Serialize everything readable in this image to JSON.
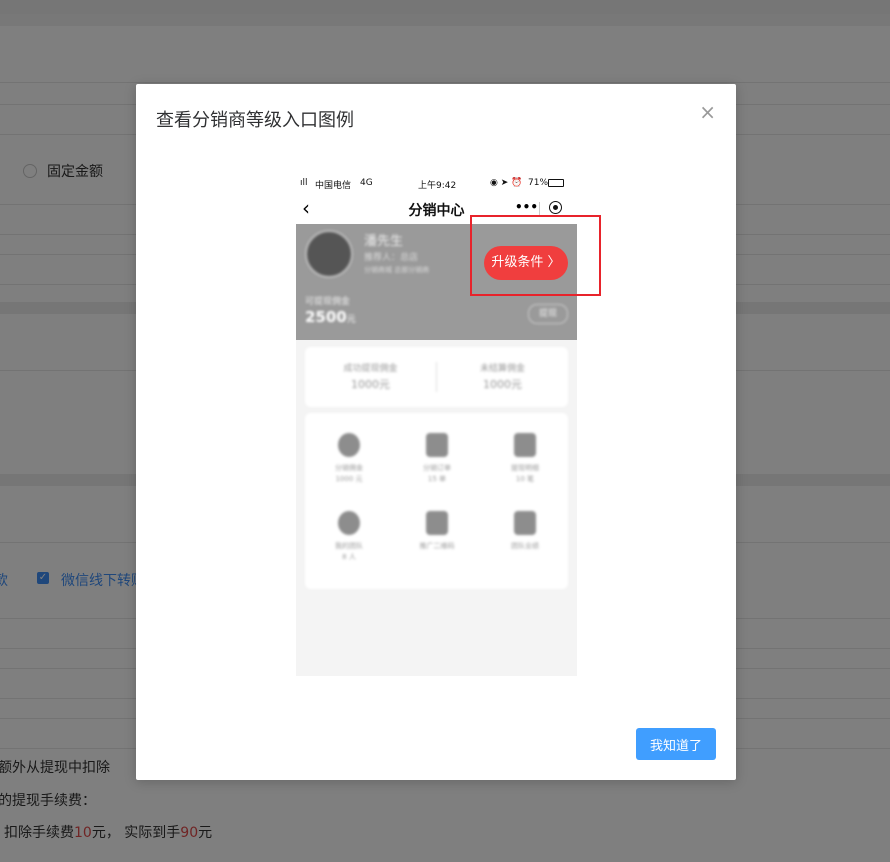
{
  "background": {
    "radio_label": "固定金额",
    "checkbox_label": "微信线下转账",
    "left_fragment": "款",
    "deduct_line": "额外从提现中扣除",
    "fee_label": "的提现手续费：",
    "example": {
      "prefix": "扣除手续费",
      "fee": "10",
      "mid": "元， 实际到手",
      "net": "90",
      "suffix": "元"
    }
  },
  "dialog": {
    "title": "查看分销商等级入口图例",
    "close_icon": "×",
    "ok_label": "我知道了"
  },
  "phone": {
    "status": {
      "carrier": "中国电信",
      "network": "4G",
      "time": "上午9:42",
      "battery": "71%"
    },
    "nav": {
      "back_icon": "‹",
      "title": "分销中心",
      "more_icon": "•••"
    },
    "header": {
      "name": "潘先生",
      "referrer": "推荐人：总店",
      "tags": "分销商城  总部分销商",
      "upgrade_label": "升级条件 〉",
      "balance_label": "可提现佣金",
      "balance_value": "2500",
      "balance_unit": "元",
      "withdraw_label": "提现"
    },
    "stats": [
      {
        "label": "成功提现佣金",
        "value": "1000元"
      },
      {
        "label": "未结算佣金",
        "value": "1000元"
      }
    ],
    "grid": [
      {
        "label": "分销佣金",
        "sub": "1000 元",
        "icon": "money-bag-icon"
      },
      {
        "label": "分销订单",
        "sub": "15 单",
        "icon": "order-icon"
      },
      {
        "label": "提现明细",
        "sub": "10 笔",
        "icon": "withdraw-detail-icon"
      },
      {
        "label": "我的团队",
        "sub": "8 人",
        "icon": "team-icon"
      },
      {
        "label": "推广二维码",
        "sub": "",
        "icon": "qrcode-icon"
      },
      {
        "label": "团队业绩",
        "sub": "",
        "icon": "performance-icon"
      }
    ]
  },
  "colors": {
    "primary": "#409eff",
    "highlight": "#e8232b",
    "upgrade": "#f03e3e"
  }
}
